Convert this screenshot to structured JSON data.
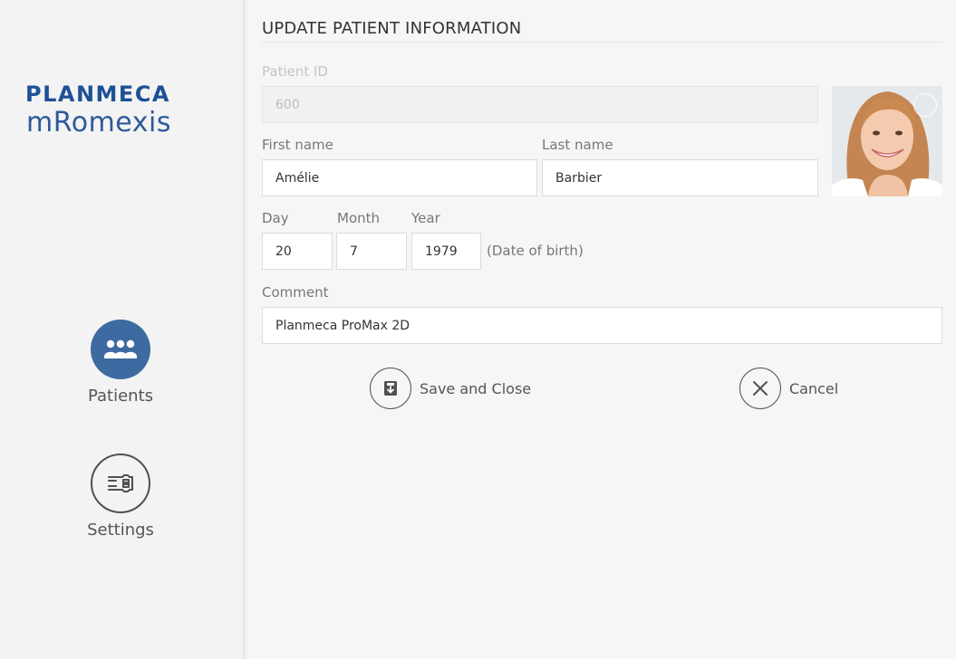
{
  "sidebar": {
    "brand_top": "PLANMECA",
    "brand_bottom": "mRomexis",
    "nav": [
      {
        "label": "Patients",
        "icon": "patients-icon",
        "active": true
      },
      {
        "label": "Settings",
        "icon": "settings-icon",
        "active": false
      }
    ]
  },
  "form": {
    "title": "UPDATE PATIENT INFORMATION",
    "patient_id": {
      "label": "Patient ID",
      "value": "600"
    },
    "first_name": {
      "label": "First name",
      "value": "Amélie"
    },
    "last_name": {
      "label": "Last name",
      "value": "Barbier"
    },
    "dob": {
      "day_label": "Day",
      "day": "20",
      "month_label": "Month",
      "month": "7",
      "year_label": "Year",
      "year": "1979",
      "note": "(Date of birth)"
    },
    "comment": {
      "label": "Comment",
      "value": "Planmeca ProMax 2D"
    },
    "photo_icon": "edit-photo-icon"
  },
  "actions": {
    "save_label": "Save and Close",
    "cancel_label": "Cancel"
  },
  "colors": {
    "brand_blue": "#1d5196",
    "accent": "#3d6aa1"
  }
}
